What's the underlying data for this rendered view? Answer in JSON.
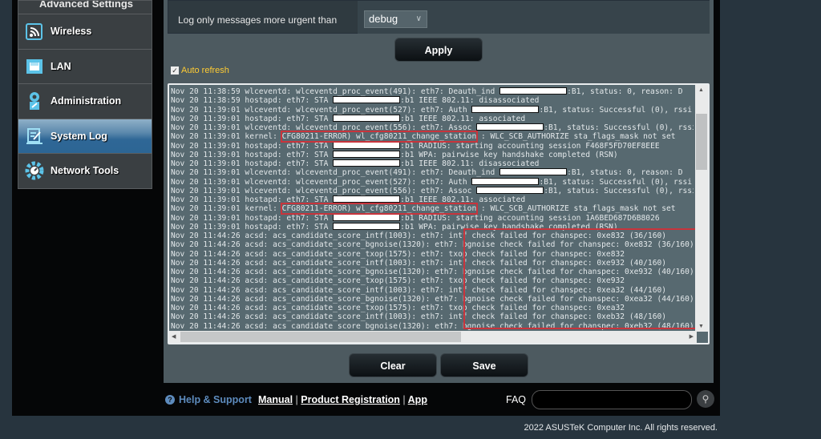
{
  "sidebar": {
    "heading": "Advanced Settings",
    "items": [
      {
        "label": "Wireless",
        "icon": "wireless-icon"
      },
      {
        "label": "LAN",
        "icon": "lan-icon"
      },
      {
        "label": "Administration",
        "icon": "administration-icon"
      },
      {
        "label": "System Log",
        "icon": "system-log-icon",
        "active": true
      },
      {
        "label": "Network Tools",
        "icon": "network-tools-icon"
      }
    ]
  },
  "settings": {
    "log_level_label": "Log only messages more urgent than",
    "log_level_value": "debug",
    "apply_label": "Apply",
    "auto_refresh_label": "Auto refresh",
    "auto_refresh_checked": true
  },
  "log": {
    "lines": [
      [
        {
          "t": "Nov 20 11:38:59 wlceventd: wlceventd_proc_event(491): eth7: Deauth_ind "
        },
        {
          "r": true
        },
        {
          "t": ":B1, status: 0, reason: D"
        }
      ],
      [
        {
          "t": "Nov 20 11:38:59 hostapd: eth7: STA "
        },
        {
          "r": true
        },
        {
          "t": ":b1 IEEE 802.11: disassociated"
        }
      ],
      [
        {
          "t": "Nov 20 11:39:01 wlceventd: wlceventd_proc_event(527): eth7: Auth "
        },
        {
          "r": true
        },
        {
          "t": ":B1, status: Successful (0), rssi"
        }
      ],
      [
        {
          "t": "Nov 20 11:39:01 hostapd: eth7: STA "
        },
        {
          "r": true
        },
        {
          "t": ":b1 IEEE 802.11: associated"
        }
      ],
      [
        {
          "t": "Nov 20 11:39:01 wlceventd: wlceventd_proc_event(556): eth7: Assoc "
        },
        {
          "r": true
        },
        {
          "t": ":B1, status: Successful (0), rssi"
        }
      ],
      [
        {
          "t": "Nov 20 11:39:01 kernel: "
        },
        {
          "t": "CFG80211-ERROR) wl_cfg80211_change_station",
          "hl": true
        },
        {
          "t": " : WLC_SCB_AUTHORIZE sta_flags_mask not set"
        }
      ],
      [
        {
          "t": "Nov 20 11:39:01 hostapd: eth7: STA "
        },
        {
          "r": true
        },
        {
          "t": ":b1 RADIUS: starting accounting session F468F5FD70EF8EEE"
        }
      ],
      [
        {
          "t": "Nov 20 11:39:01 hostapd: eth7: STA "
        },
        {
          "r": true
        },
        {
          "t": ":b1 WPA: pairwise key handshake completed (RSN)"
        }
      ],
      [
        {
          "t": "Nov 20 11:39:01 hostapd: eth7: STA "
        },
        {
          "r": true
        },
        {
          "t": ":b1 IEEE 802.11: disassociated"
        }
      ],
      [
        {
          "t": "Nov 20 11:39:01 wlceventd: wlceventd_proc_event(491): eth7: Deauth_ind "
        },
        {
          "r": true
        },
        {
          "t": ":B1, status: 0, reason: D"
        }
      ],
      [
        {
          "t": "Nov 20 11:39:01 wlceventd: wlceventd_proc_event(527): eth7: Auth "
        },
        {
          "r": true
        },
        {
          "t": ":B1, status: Successful (0), rssi"
        }
      ],
      [
        {
          "t": "Nov 20 11:39:01 wlceventd: wlceventd_proc_event(556): eth7: Assoc "
        },
        {
          "r": true
        },
        {
          "t": ":B1, status: Successful (0), rssi"
        }
      ],
      [
        {
          "t": "Nov 20 11:39:01 hostapd: eth7: STA "
        },
        {
          "r": true
        },
        {
          "t": ":b1 IEEE 802.11: associated"
        }
      ],
      [
        {
          "t": "Nov 20 11:39:01 kernel: "
        },
        {
          "t": "CFG80211-ERROR) wl_cfg80211_change_station",
          "hl": true
        },
        {
          "t": " : WLC_SCB_AUTHORIZE sta_flags_mask not set"
        }
      ],
      [
        {
          "t": "Nov 20 11:39:01 hostapd: eth7: STA "
        },
        {
          "r": true
        },
        {
          "t": ":b1 RADIUS: starting accounting session 1A6BED687D6B8026"
        }
      ],
      [
        {
          "t": "Nov 20 11:39:01 hostapd: eth7: STA "
        },
        {
          "r": true
        },
        {
          "t": ":b1 WPA: pairwise key handshake completed (RSN)"
        }
      ],
      [
        {
          "t": "Nov 20 11:44:26 acsd: acs_candidate_score_intf(1003): eth7: intf check failed for chanspec: 0xe832 (36/160)"
        }
      ],
      [
        {
          "t": "Nov 20 11:44:26 acsd: acs_candidate_score_bgnoise(1320): eth7: bgnoise check failed for chanspec: 0xe832 (36/160)"
        }
      ],
      [
        {
          "t": "Nov 20 11:44:26 acsd: acs_candidate_score_txop(1575): eth7: txop check failed for chanspec: 0xe832"
        }
      ],
      [
        {
          "t": "Nov 20 11:44:26 acsd: acs_candidate_score_intf(1003): eth7: intf check failed for chanspec: 0xe932 (40/160)"
        }
      ],
      [
        {
          "t": "Nov 20 11:44:26 acsd: acs_candidate_score_bgnoise(1320): eth7: bgnoise check failed for chanspec: 0xe932 (40/160)"
        }
      ],
      [
        {
          "t": "Nov 20 11:44:26 acsd: acs_candidate_score_txop(1575): eth7: txop check failed for chanspec: 0xe932"
        }
      ],
      [
        {
          "t": "Nov 20 11:44:26 acsd: acs_candidate_score_intf(1003): eth7: intf check failed for chanspec: 0xea32 (44/160)"
        }
      ],
      [
        {
          "t": "Nov 20 11:44:26 acsd: acs_candidate_score_bgnoise(1320): eth7: bgnoise check failed for chanspec: 0xea32 (44/160)"
        }
      ],
      [
        {
          "t": "Nov 20 11:44:26 acsd: acs_candidate_score_txop(1575): eth7: txop check failed for chanspec: 0xea32"
        }
      ],
      [
        {
          "t": "Nov 20 11:44:26 acsd: acs_candidate_score_intf(1003): eth7: intf check failed for chanspec: 0xeb32 (48/160)"
        }
      ],
      [
        {
          "t": "Nov 20 11:44:26 acsd: acs_candidate_score_bgnoise(1320): eth7: bgnoise check failed for chanspec: 0xeb32 (48/160)"
        }
      ]
    ],
    "highlight_color": "#c8343c"
  },
  "actions": {
    "clear_label": "Clear",
    "save_label": "Save"
  },
  "footer": {
    "help_label": "Help & Support",
    "links": [
      "Manual",
      "Product Registration",
      "App"
    ],
    "faq_label": "FAQ",
    "copyright": "2022 ASUSTeK Computer Inc. All rights reserved."
  }
}
